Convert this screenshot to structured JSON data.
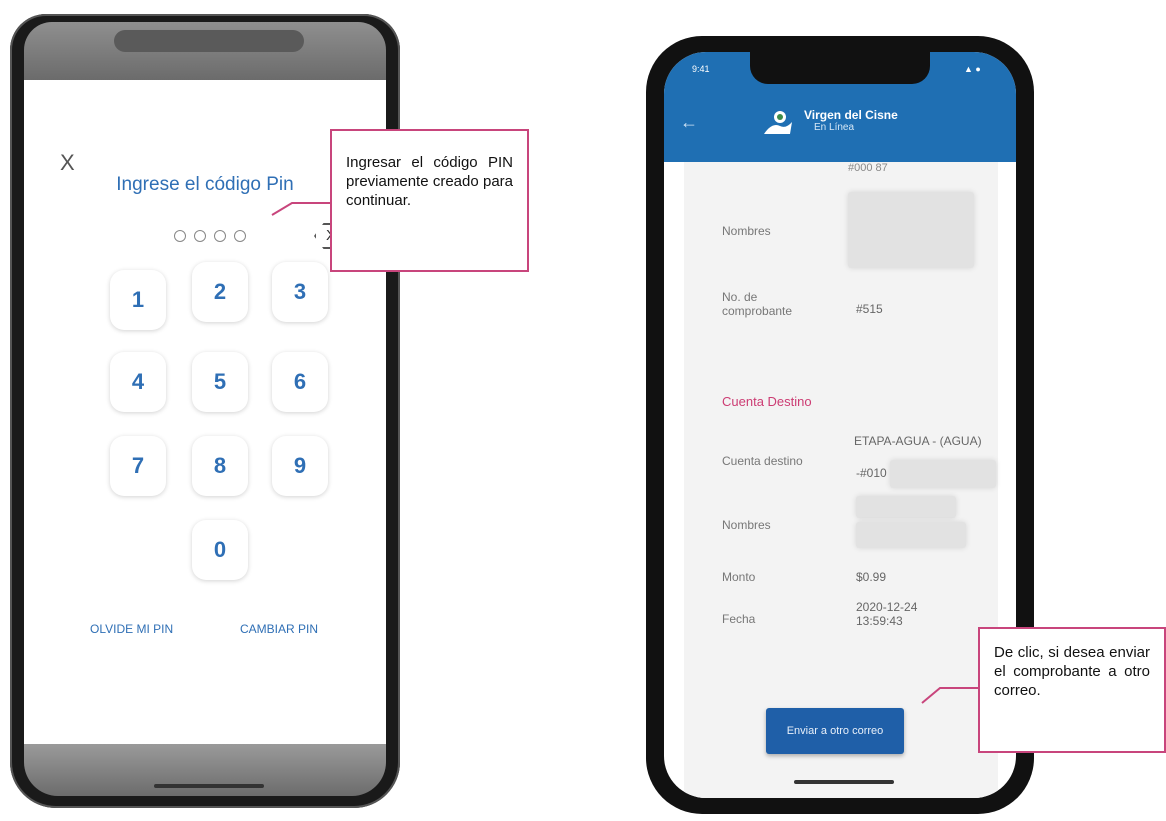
{
  "pin_screen": {
    "close_label": "X",
    "title": "Ingrese el código Pin",
    "backspace_label": "X",
    "keys": [
      "1",
      "2",
      "3",
      "4",
      "5",
      "6",
      "7",
      "8",
      "9",
      "0"
    ],
    "forgot_pin": "OLVIDE MI PIN",
    "change_pin": "CAMBIAR PIN"
  },
  "receipt_screen": {
    "status_left": "9:41",
    "status_right": "▲ ●",
    "back_icon": "arrow-left-icon",
    "app_title": "Virgen del Cisne",
    "app_subtitle": "En Línea",
    "cut_text": "#000          87",
    "origin": {
      "names_label": "Nombres",
      "receipt_label": "No. de comprobante",
      "receipt_value": "#515"
    },
    "destination": {
      "section_title": "Cuenta Destino",
      "account_label": "Cuenta destino",
      "account_value": "ETAPA-AGUA - (AGUA)",
      "account_number": "-#010",
      "names_label": "Nombres",
      "amount_label": "Monto",
      "amount_value": "$0.99",
      "date_label": "Fecha",
      "date_value": "2020-12-24 13:59:43"
    },
    "send_button": "Enviar a otro correo"
  },
  "callouts": {
    "pin": "Ingresar el código PIN previamente creado para continuar.",
    "send": "De clic, si desea enviar el comprobante a otro correo."
  },
  "colors": {
    "brand_blue": "#1f6fb3",
    "pin_blue": "#2f6fb5",
    "accent_pink": "#c8457c",
    "section_pink": "#cc3c73"
  }
}
